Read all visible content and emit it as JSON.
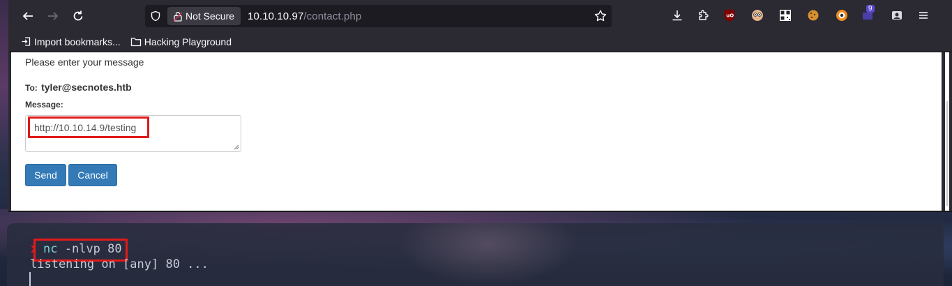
{
  "browser": {
    "security_label": "Not Secure",
    "url_host": "10.10.10.97",
    "url_path": "/contact.php",
    "extension_badge": "9",
    "bookmarks": [
      {
        "label": "Import bookmarks..."
      },
      {
        "label": "Hacking Playground"
      }
    ]
  },
  "page": {
    "intro": "Please enter your message",
    "to_label": "To:",
    "to_address": "tyler@secnotes.htb",
    "message_label": "Message:",
    "message_value": "http://10.10.14.9/testing",
    "send_label": "Send",
    "cancel_label": "Cancel"
  },
  "terminal": {
    "command": "nc",
    "args": "-nlvp 80",
    "output": "listening on [any] 80 ..."
  },
  "colors": {
    "highlight": "#e21a1a",
    "button": "#337ab7"
  }
}
